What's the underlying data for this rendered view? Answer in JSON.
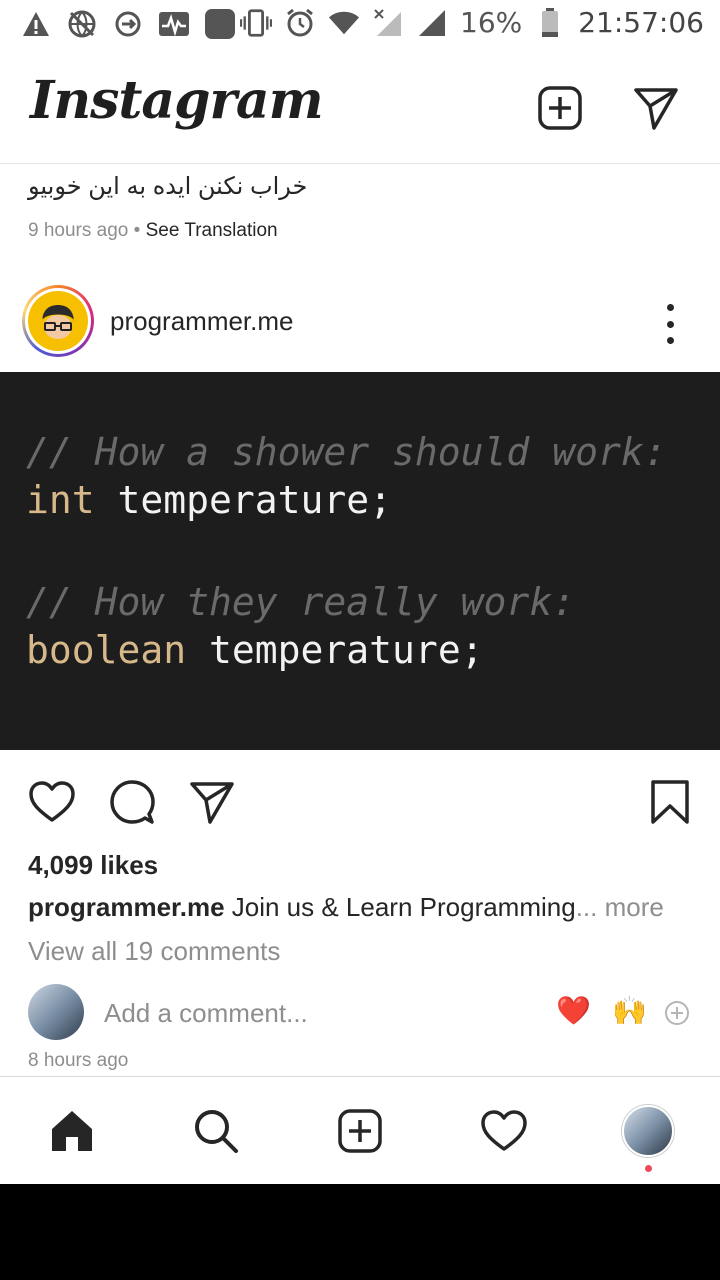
{
  "status_bar": {
    "battery": "16%",
    "time": "21:57:06"
  },
  "header": {
    "logo": "Instagram"
  },
  "previous_post": {
    "caption": "خراب نکنن ایده به این خوبیو",
    "time_ago": "9 hours ago",
    "separator": "•",
    "see_translation": "See Translation"
  },
  "post": {
    "username": "programmer.me",
    "code": {
      "line1_comment": "// How a shower should work:",
      "line2_keyword": "int",
      "line2_rest": " temperature;",
      "line3_comment": "// How they really work:",
      "line4_keyword": "boolean",
      "line4_rest": " temperature;"
    },
    "likes": "4,099 likes",
    "caption_user": "programmer.me",
    "caption_text": " Join us & Learn Programming",
    "caption_more": "... more",
    "view_comments": "View all 19 comments",
    "add_comment_placeholder": "Add a comment...",
    "quick_emoji_1": "❤️",
    "quick_emoji_2": "🙌",
    "time_ago": "8 hours ago"
  },
  "colors": {
    "notification_dot": "#ed4956",
    "code_bg": "#1d1d1d",
    "code_keyword": "#d6b88a",
    "code_comment": "#6a6a6a"
  }
}
